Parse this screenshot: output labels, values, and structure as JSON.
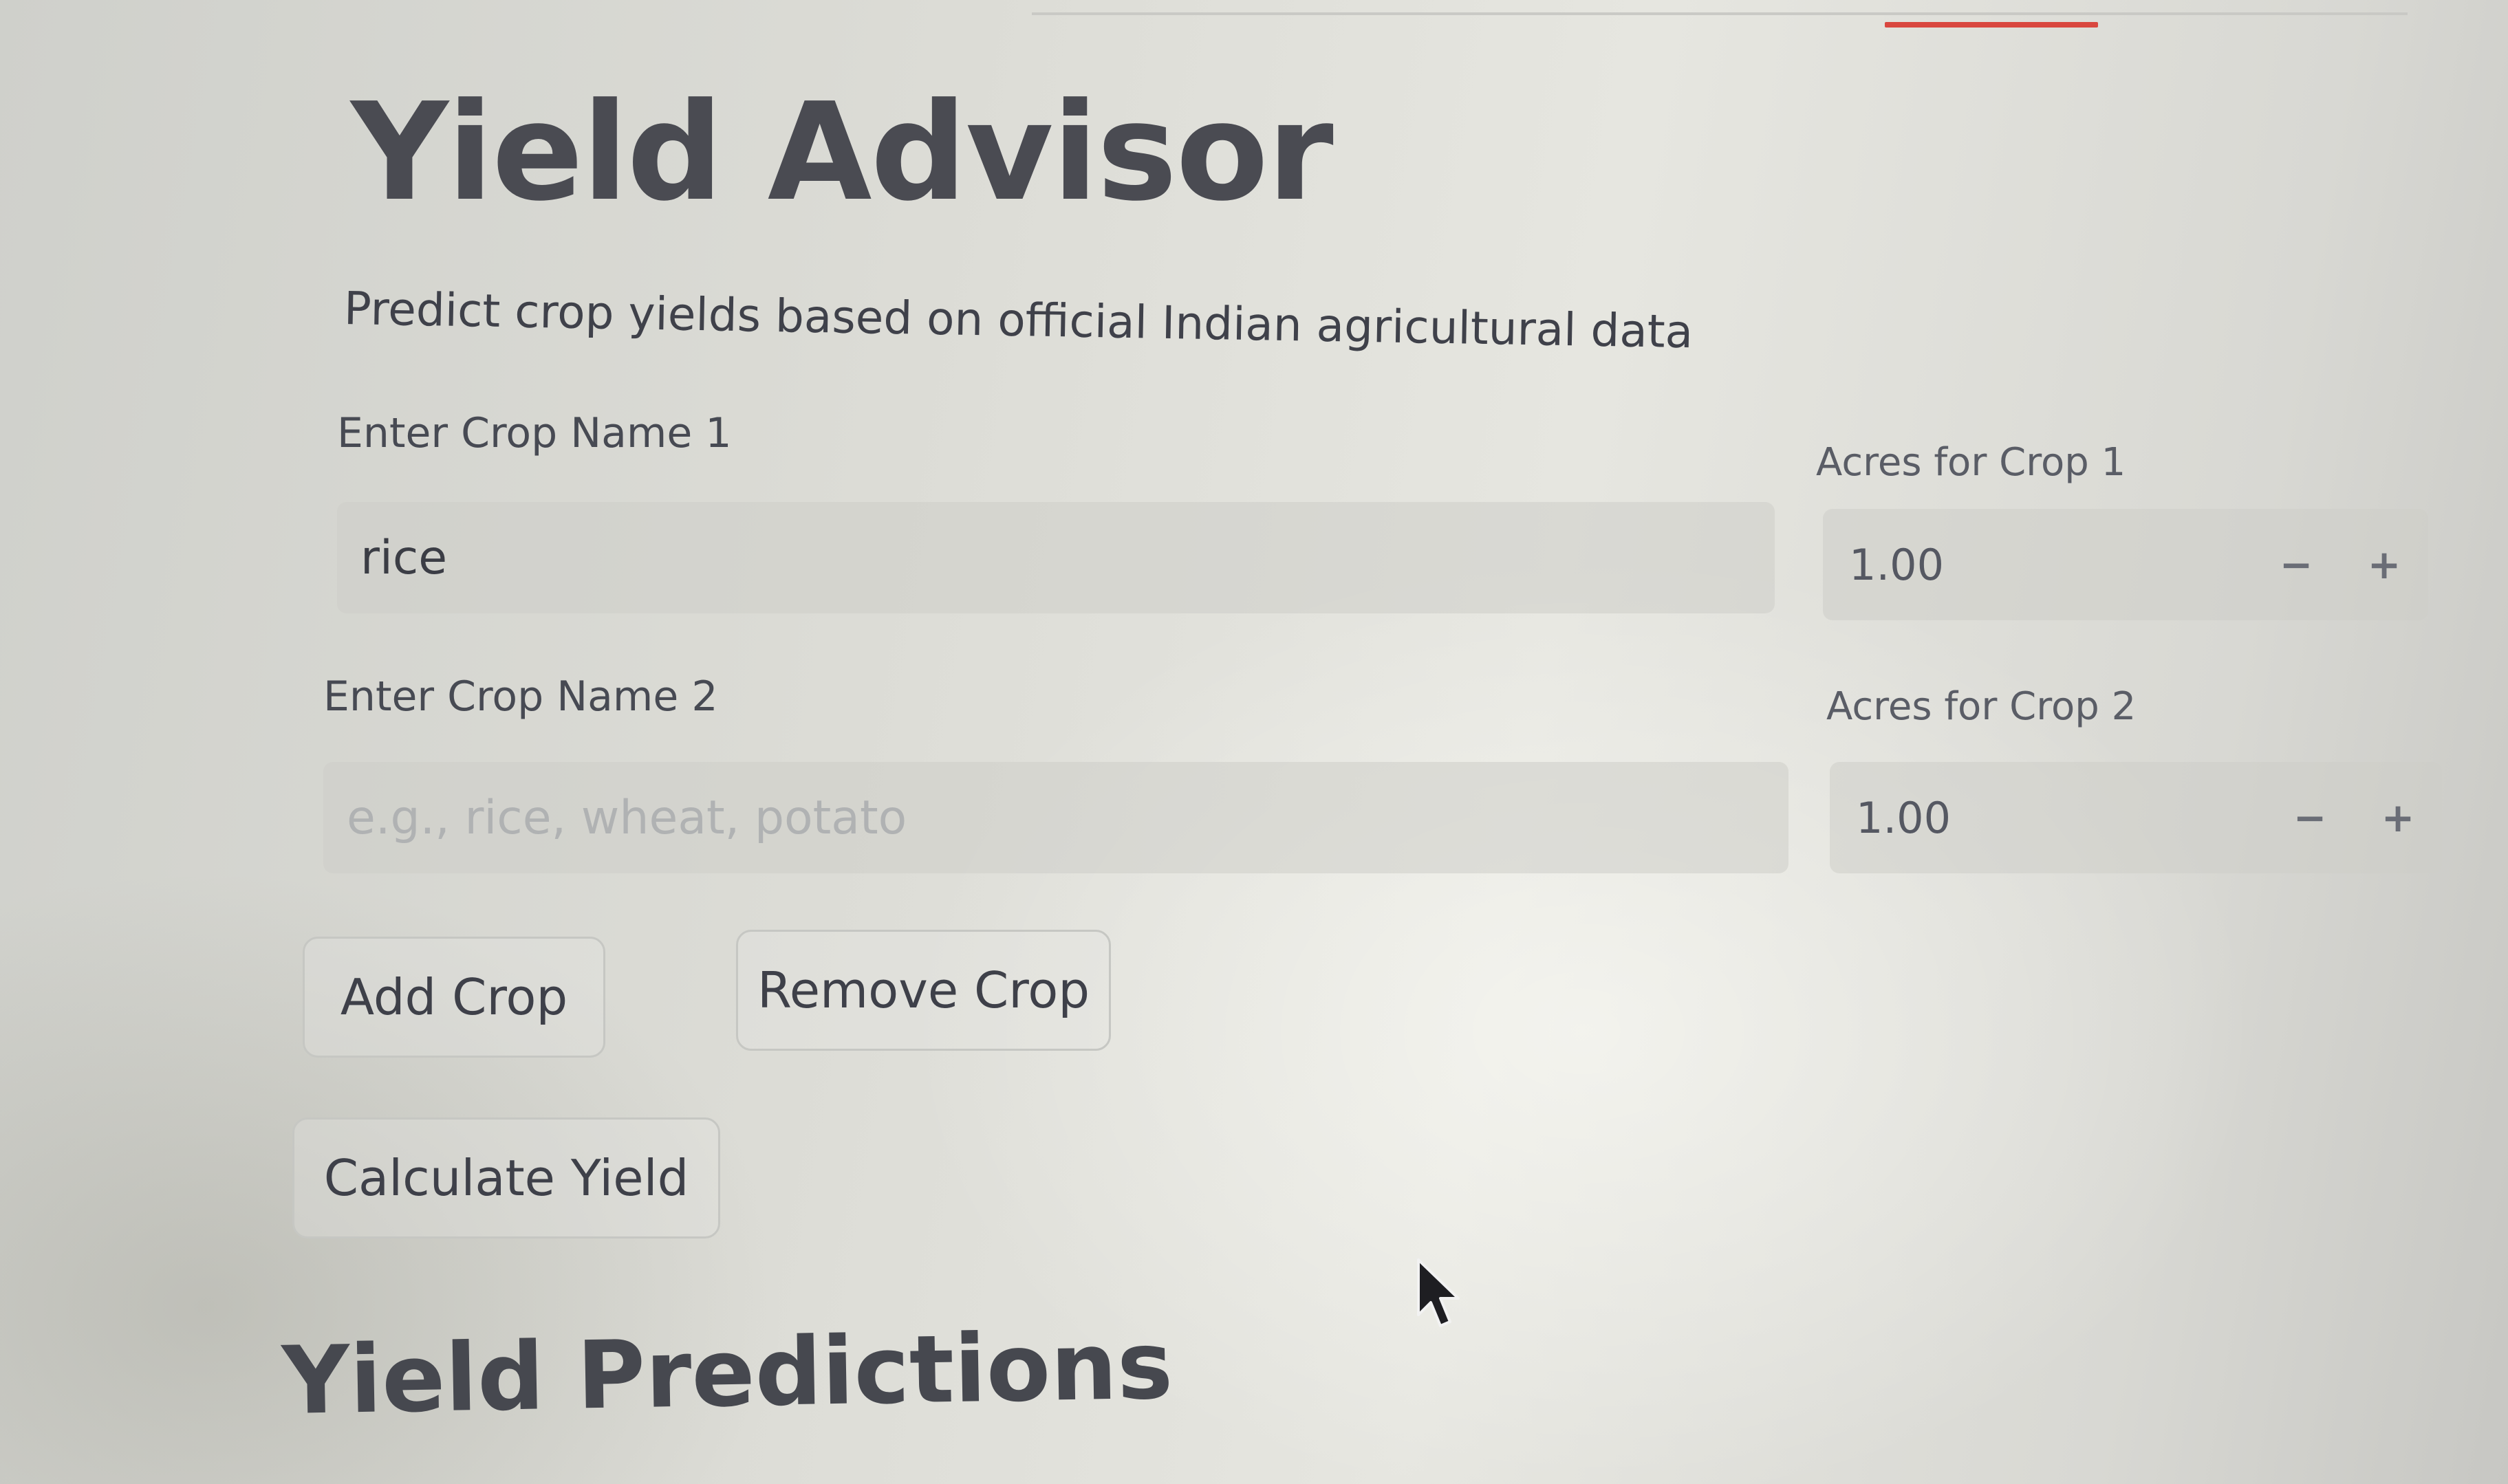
{
  "app": {
    "title": "Yield Advisor",
    "subtitle": "Predict crop yields based on official Indian agricultural data"
  },
  "crops": [
    {
      "name_label": "Enter Crop Name 1",
      "name_value": "rice",
      "name_placeholder": "e.g., rice, wheat, potato",
      "acres_label": "Acres for Crop 1",
      "acres_value": "1.00"
    },
    {
      "name_label": "Enter Crop Name 2",
      "name_value": "",
      "name_placeholder": "e.g., rice, wheat, potato",
      "acres_label": "Acres for Crop 2",
      "acres_value": "1.00"
    }
  ],
  "stepper": {
    "decrement_label": "−",
    "increment_label": "+"
  },
  "buttons": {
    "add_crop": "Add Crop",
    "remove_crop": "Remove Crop",
    "calculate_yield": "Calculate Yield"
  },
  "results": {
    "heading": "Yield Predictions"
  },
  "colors": {
    "accent": "#d9473f",
    "text": "#3b3d45"
  }
}
